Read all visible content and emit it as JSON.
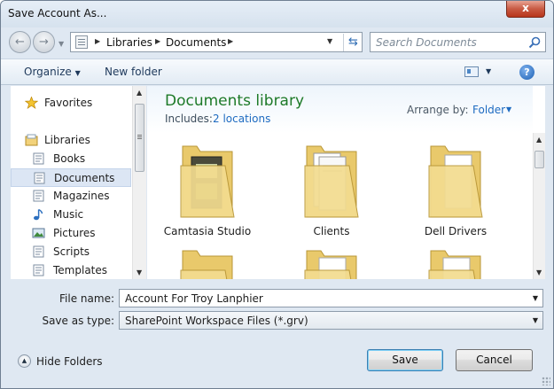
{
  "window": {
    "title": "Save Account As...",
    "close_glyph": "x"
  },
  "nav": {
    "back_glyph": "←",
    "forward_glyph": "→",
    "breadcrumb": [
      "Libraries",
      "Documents"
    ],
    "search_placeholder": "Search Documents"
  },
  "toolbar": {
    "organize_label": "Organize",
    "new_folder_label": "New folder",
    "help_glyph": "?"
  },
  "sidebar": {
    "items": [
      {
        "label": "Favorites",
        "icon": "star-icon"
      },
      {
        "label": "Libraries",
        "icon": "libraries-icon"
      },
      {
        "label": "Books",
        "icon": "document-library-icon"
      },
      {
        "label": "Documents",
        "icon": "document-library-icon",
        "selected": true
      },
      {
        "label": "Magazines",
        "icon": "document-library-icon"
      },
      {
        "label": "Music",
        "icon": "music-note-icon"
      },
      {
        "label": "Pictures",
        "icon": "pictures-icon"
      },
      {
        "label": "Scripts",
        "icon": "document-library-icon"
      },
      {
        "label": "Templates",
        "icon": "document-library-icon"
      }
    ]
  },
  "library": {
    "title": "Documents library",
    "includes_label": "Includes:",
    "includes_link": "2 locations",
    "arrange_label": "Arrange by:",
    "arrange_value": "Folder"
  },
  "folders": [
    {
      "label": "Camtasia Studio",
      "icon": "film-folder-icon"
    },
    {
      "label": "Clients",
      "icon": "documents-folder-icon"
    },
    {
      "label": "Dell Drivers",
      "icon": "folder-icon"
    },
    {
      "label": "",
      "icon": "folder-icon"
    },
    {
      "label": "",
      "icon": "folder-icon"
    },
    {
      "label": "",
      "icon": "folder-icon"
    }
  ],
  "form": {
    "file_name_label": "File name:",
    "file_name_value": "Account For Troy Lanphier",
    "save_type_label": "Save as type:",
    "save_type_value": "SharePoint Workspace Files (*.grv)"
  },
  "footer": {
    "hide_folders_label": "Hide Folders",
    "save_label": "Save",
    "cancel_label": "Cancel"
  },
  "colors": {
    "library_title": "#1e7a28",
    "link": "#1e6bc1",
    "window_frame": "#dfe8f2"
  }
}
